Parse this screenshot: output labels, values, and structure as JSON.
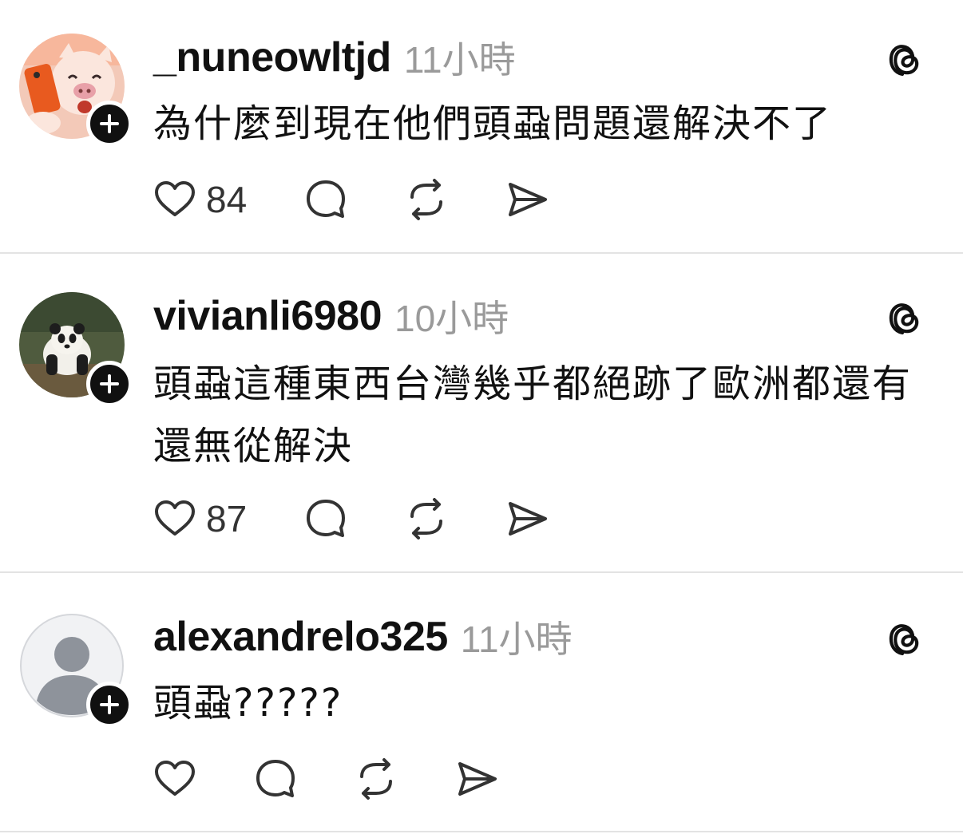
{
  "posts": [
    {
      "username": "_nuneowltjd",
      "time": "11小時",
      "text": "為什麼到現在他們頭蝨問題還解決不了",
      "likes": "84",
      "avatar": "pig-character-avatar"
    },
    {
      "username": "vivianli6980",
      "time": "10小時",
      "text": "頭蝨這種東西台灣幾乎都絕跡了歐洲都還有還無從解決",
      "likes": "87",
      "avatar": "panda-photo-avatar"
    },
    {
      "username": "alexandrelo325",
      "time": "11小時",
      "text": "頭蝨?????",
      "likes": "",
      "avatar": "default-user-avatar"
    }
  ],
  "icons": {
    "like": "heart-icon",
    "reply": "comment-bubble-icon",
    "repost": "repost-icon",
    "share": "send-icon",
    "app": "threads-logo-icon",
    "follow": "plus-icon"
  },
  "colors": {
    "text": "#111111",
    "muted": "#9a9a9a",
    "divider": "#e3e3e3",
    "badge": "#101010"
  }
}
